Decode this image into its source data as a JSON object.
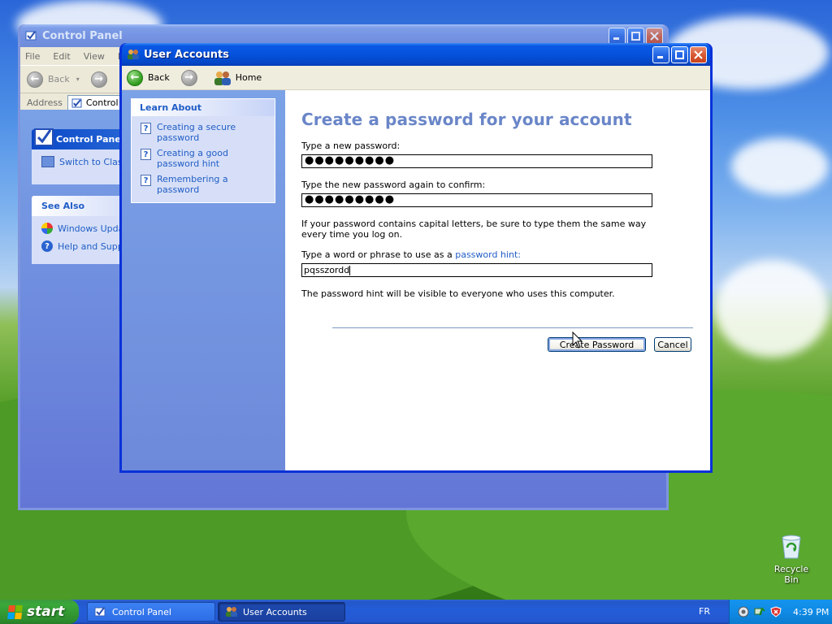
{
  "control_panel": {
    "title": "Control Panel",
    "menu": [
      "File",
      "Edit",
      "View",
      "F"
    ],
    "back_label": "Back",
    "address_label": "Address",
    "address_value": "Control Pa",
    "panel_title": "Control Panel",
    "switch_label": "Switch to Class",
    "see_also_title": "See Also",
    "see_also_items": [
      "Windows Upda",
      "Help and Suppo"
    ]
  },
  "user_accounts": {
    "title": "User Accounts",
    "nav": {
      "back": "Back",
      "home": "Home"
    },
    "learn_about": {
      "title": "Learn About",
      "items": [
        "Creating a secure password",
        "Creating a good password hint",
        "Remembering a password"
      ]
    },
    "heading": "Create a password for your account",
    "new_password_label": "Type a new password:",
    "new_password_value": "●●●●●●●●●",
    "confirm_label": "Type the new password again to confirm:",
    "confirm_value": "●●●●●●●●●",
    "caps_note": "If your password contains capital letters, be sure to type them the same way every time you log on.",
    "hint_label_prefix": "Type a word or phrase to use as a ",
    "hint_link": "password hint:",
    "hint_value": "pqsszordd",
    "hint_note": "The password hint will be visible to everyone who uses this computer.",
    "create_button": "Create Password",
    "cancel_button": "Cancel"
  },
  "desktop": {
    "recycle_bin": "Recycle Bin"
  },
  "taskbar": {
    "start": "start",
    "buttons": [
      "Control Panel",
      "User Accounts"
    ],
    "language": "FR",
    "clock": "4:39 PM"
  },
  "colors": {
    "xp_blue": "#0831d9",
    "heading": "#6a86c8",
    "link": "#215dc6",
    "start_green": "#3aa83a"
  }
}
